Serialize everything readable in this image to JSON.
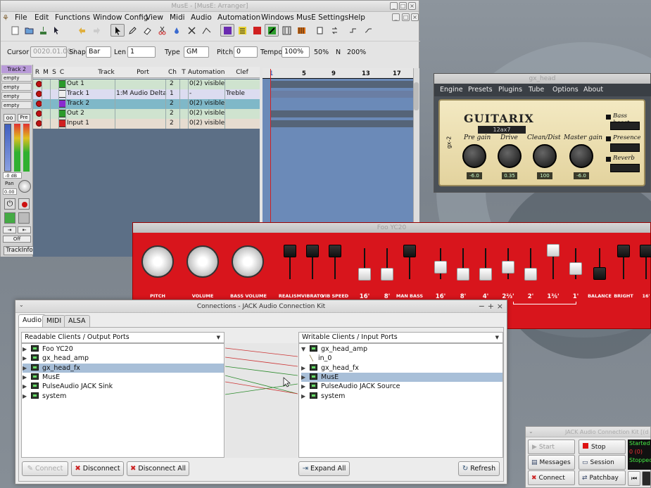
{
  "muse": {
    "title": "MusE - [MusE: Arranger]",
    "menu": [
      "File",
      "Edit",
      "Functions",
      "Window Config",
      "View",
      "Midi",
      "Audio",
      "Automation",
      "Windows",
      "MusE Settings",
      "Help"
    ],
    "cursor_label": "Cursor",
    "cursor_value": "0020.01.000",
    "snap_label": "Snap",
    "snap_value": "Bar",
    "len_label": "Len",
    "len_value": "1",
    "type_label": "Type",
    "type_value": "GM",
    "pitch_label": "Pitch",
    "pitch_value": "0",
    "tempo_label": "Tempo",
    "tempo_value": "100%",
    "zoom_50": "50%",
    "n_label": "N",
    "zoom_200": "200%",
    "trackinfo_title": "Track 2",
    "empty_slots": [
      "empty",
      "empty",
      "empty",
      "empty"
    ],
    "pre_label": "Pre",
    "db_label": "-0 dB",
    "pan_label": "Pan",
    "pan_value": "0.00",
    "off_label": "Off",
    "trackinfo_tab": "TrackInfo",
    "columns": [
      "R",
      "M",
      "S",
      "C",
      "Track",
      "Port",
      "Ch",
      "T",
      "Automation",
      "Clef"
    ],
    "tracks": [
      {
        "name": "Out 1",
        "port": "",
        "ch": "2",
        "auto": "0(2) visible",
        "clef": "",
        "icon": "audio-out-icon",
        "color": "#cfe3cf"
      },
      {
        "name": "Track 1",
        "port": "1:M Audio Delta",
        "ch": "1",
        "auto": "-",
        "clef": "Treble",
        "icon": "midi-track-icon",
        "color": "#dcdcf0"
      },
      {
        "name": "Track 2",
        "port": "",
        "ch": "2",
        "auto": "0(2) visible",
        "clef": "",
        "icon": "synth-track-icon",
        "color": "#7fb8c8"
      },
      {
        "name": "Out 2",
        "port": "",
        "ch": "2",
        "auto": "0(2) visible",
        "clef": "",
        "icon": "audio-out-icon",
        "color": "#cfe3cf"
      },
      {
        "name": "Input 1",
        "port": "",
        "ch": "2",
        "auto": "0(2) visible",
        "clef": "",
        "icon": "audio-in-icon",
        "color": "#e6dcd0"
      }
    ],
    "ruler": [
      "1",
      "5",
      "9",
      "13",
      "17"
    ]
  },
  "guitarix": {
    "title": "gx_head",
    "menu": [
      "Engine",
      "Presets",
      "Plugins",
      "Tube",
      "Options",
      "About"
    ],
    "brand": "GUITARIX",
    "model": "12ax7",
    "side_label": "gx-2",
    "knobs": [
      {
        "label": "Pre gain",
        "value": "-6.0"
      },
      {
        "label": "Drive",
        "value": "0.35"
      },
      {
        "label": "Clean/Dist",
        "value": "100"
      },
      {
        "label": "Master gain",
        "value": "-6.0"
      }
    ],
    "switches": [
      "Bass boost",
      "Presence",
      "Reverb"
    ]
  },
  "yc20": {
    "title": "Foo YC20",
    "labels": [
      "PITCH",
      "VOLUME",
      "BASS VOLUME",
      "REALISM",
      "VIBRATO",
      "VIB SPEED",
      "16'",
      "8'",
      "MAN BASS",
      "16'",
      "8'",
      "4'",
      "2⅔'",
      "2'",
      "1⅗'",
      "1'",
      "BALANCE",
      "BRIGHT",
      "16'"
    ]
  },
  "connections": {
    "title": "Connections - JACK Audio Connection Kit",
    "tabs": [
      "Audio",
      "MIDI",
      "ALSA"
    ],
    "left_header": "Readable Clients / Output Ports",
    "right_header": "Writable Clients / Input Ports",
    "left_items": [
      "Foo YC20",
      "gx_head_amp",
      "gx_head_fx",
      "MusE",
      "PulseAudio JACK Sink",
      "system"
    ],
    "right_items": [
      "gx_head_amp",
      "in_0",
      "gx_head_fx",
      "MusE",
      "PulseAudio JACK Source",
      "system"
    ],
    "connect": "Connect",
    "disconnect": "Disconnect",
    "disconnect_all": "Disconnect All",
    "expand_all": "Expand All",
    "refresh": "Refresh"
  },
  "qjackctl": {
    "title": "JACK Audio Connection Kit [(d",
    "start": "Start",
    "stop": "Stop",
    "messages": "Messages",
    "session": "Session",
    "connect": "Connect",
    "patchbay": "Patchbay",
    "status1": "Started",
    "status2": "0 (0)",
    "status3": "Stopped"
  },
  "colors": {
    "accent": "#a8bfd8",
    "record": "#b11111",
    "yc20_red": "#d8151c",
    "guitarix_panel": "#efe3b7"
  }
}
